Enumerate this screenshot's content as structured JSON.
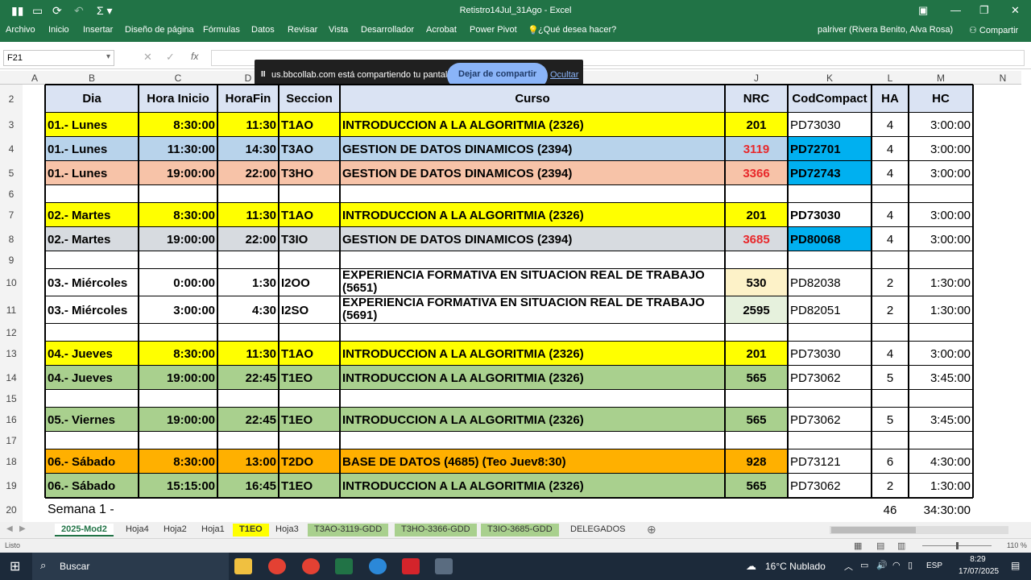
{
  "window": {
    "title": "Retistro14Jul_31Ago - Excel",
    "user": "palriver (Rivera Benito, Alva Rosa)",
    "share": "Compartir"
  },
  "menu": [
    "Archivo",
    "Inicio",
    "Insertar",
    "Diseño de página",
    "Fórmulas",
    "Datos",
    "Revisar",
    "Vista",
    "Desarrollador",
    "Acrobat",
    "Power Pivot",
    "¿Qué desea hacer?"
  ],
  "formula": {
    "namebox": "F21",
    "fx": "fx"
  },
  "sharebar": {
    "text": "us.bbcollab.com está compartiendo tu pantalla.",
    "stop": "Dejar de compartir",
    "hide": "Ocultar",
    "pause": "II"
  },
  "columns": [
    "A",
    "B",
    "C",
    "D",
    "E",
    "F",
    "G",
    "H",
    "I",
    "J",
    "K",
    "L",
    "M",
    "N"
  ],
  "headers": [
    "Dia",
    "Hora Inicio",
    "HoraFin",
    "Seccion",
    "Curso",
    "NRC",
    "CodCompact",
    "HA",
    "HC"
  ],
  "rows": [
    {
      "n": "3",
      "dia": "01.- Lunes",
      "ini": "8:30:00",
      "fin": "11:30",
      "sec": "T1AO",
      "curso": "INTRODUCCION A LA ALGORITMIA (2326)",
      "nrc": "201",
      "cod": "PD73030",
      "ha": "4",
      "hc": "3:00:00"
    },
    {
      "n": "4",
      "dia": "01.- Lunes",
      "ini": "11:30:00",
      "fin": "14:30",
      "sec": "T3AO",
      "curso": "GESTION DE DATOS DINAMICOS (2394)",
      "nrc": "3119",
      "cod": "PD72701",
      "ha": "4",
      "hc": "3:00:00"
    },
    {
      "n": "5",
      "dia": "01.- Lunes",
      "ini": "19:00:00",
      "fin": "22:00",
      "sec": "T3HO",
      "curso": "GESTION DE DATOS DINAMICOS (2394)",
      "nrc": "3366",
      "cod": "PD72743",
      "ha": "4",
      "hc": "3:00:00"
    },
    {
      "n": "6",
      "dia": "",
      "ini": "",
      "fin": "",
      "sec": "",
      "curso": "",
      "nrc": "",
      "cod": "",
      "ha": "",
      "hc": ""
    },
    {
      "n": "7",
      "dia": "02.- Martes",
      "ini": "8:30:00",
      "fin": "11:30",
      "sec": "T1AO",
      "curso": "INTRODUCCION A LA ALGORITMIA (2326)",
      "nrc": "201",
      "cod": "PD73030",
      "ha": "4",
      "hc": "3:00:00"
    },
    {
      "n": "8",
      "dia": "02.- Martes",
      "ini": "19:00:00",
      "fin": "22:00",
      "sec": "T3IO",
      "curso": "GESTION DE DATOS DINAMICOS (2394)",
      "nrc": "3685",
      "cod": "PD80068",
      "ha": "4",
      "hc": "3:00:00"
    },
    {
      "n": "9",
      "dia": "",
      "ini": "",
      "fin": "",
      "sec": "",
      "curso": "",
      "nrc": "",
      "cod": "",
      "ha": "",
      "hc": ""
    },
    {
      "n": "10",
      "dia": "03.- Miércoles",
      "ini": "0:00:00",
      "fin": "1:30",
      "sec": "I2OO",
      "curso": "EXPERIENCIA FORMATIVA EN SITUACION REAL DE TRABAJO (5651)",
      "nrc": "530",
      "cod": "PD82038",
      "ha": "2",
      "hc": "1:30:00"
    },
    {
      "n": "11",
      "dia": "03.- Miércoles",
      "ini": "3:00:00",
      "fin": "4:30",
      "sec": "I2SO",
      "curso": "EXPERIENCIA FORMATIVA EN SITUACION REAL DE TRABAJO (5691)",
      "nrc": "2595",
      "cod": "PD82051",
      "ha": "2",
      "hc": "1:30:00"
    },
    {
      "n": "12",
      "dia": "",
      "ini": "",
      "fin": "",
      "sec": "",
      "curso": "",
      "nrc": "",
      "cod": "",
      "ha": "",
      "hc": ""
    },
    {
      "n": "13",
      "dia": "04.- Jueves",
      "ini": "8:30:00",
      "fin": "11:30",
      "sec": "T1AO",
      "curso": "INTRODUCCION A LA ALGORITMIA (2326)",
      "nrc": "201",
      "cod": "PD73030",
      "ha": "4",
      "hc": "3:00:00"
    },
    {
      "n": "14",
      "dia": "04.- Jueves",
      "ini": "19:00:00",
      "fin": "22:45",
      "sec": "T1EO",
      "curso": "INTRODUCCION A LA ALGORITMIA (2326)",
      "nrc": "565",
      "cod": "PD73062",
      "ha": "5",
      "hc": "3:45:00"
    },
    {
      "n": "15",
      "dia": "",
      "ini": "",
      "fin": "",
      "sec": "",
      "curso": "",
      "nrc": "",
      "cod": "",
      "ha": "",
      "hc": ""
    },
    {
      "n": "16",
      "dia": "05.- Viernes",
      "ini": "19:00:00",
      "fin": "22:45",
      "sec": "T1EO",
      "curso": "INTRODUCCION A LA ALGORITMIA (2326)",
      "nrc": "565",
      "cod": "PD73062",
      "ha": "5",
      "hc": "3:45:00"
    },
    {
      "n": "17",
      "dia": "",
      "ini": "",
      "fin": "",
      "sec": "",
      "curso": "",
      "nrc": "",
      "cod": "",
      "ha": "",
      "hc": ""
    },
    {
      "n": "18",
      "dia": "06.- Sábado",
      "ini": "8:30:00",
      "fin": "13:00",
      "sec": "T2DO",
      "curso": "BASE DE DATOS (4685) (Teo Juev8:30)",
      "nrc": "928",
      "cod": "PD73121",
      "ha": "6",
      "hc": "4:30:00"
    },
    {
      "n": "19",
      "dia": "06.- Sábado",
      "ini": "15:15:00",
      "fin": "16:45",
      "sec": "T1EO",
      "curso": "INTRODUCCION A LA ALGORITMIA (2326)",
      "nrc": "565",
      "cod": "PD73062",
      "ha": "2",
      "hc": "1:30:00"
    }
  ],
  "total": {
    "label": "Semana 1 -",
    "ha": "46",
    "hc": "34:30:00"
  },
  "tabs": [
    "2025-Mod2",
    "Hoja4",
    "Hoja2",
    "Hoja1",
    "T1EO",
    "Hoja3",
    "T3AO-3119-GDD",
    "T3HO-3366-GDD",
    "T3IO-3685-GDD",
    "DELEGADOS"
  ],
  "status": {
    "left": "Listo",
    "zoom": "110 %"
  },
  "taskbar": {
    "search": "Buscar",
    "weather": "16°C  Nublado",
    "lang": "ESP",
    "time": "8:29",
    "date": "17/07/2025"
  },
  "colors": {
    "yellow": "#ffff00",
    "blue": "#b8d3eb",
    "salmon": "#f7c3a8",
    "gray": "#d7dbe0",
    "green": "#a9d08e",
    "orange": "#ffb000",
    "cyan": "#00b0f0",
    "red": "#e8282b",
    "excel": "#217346"
  }
}
